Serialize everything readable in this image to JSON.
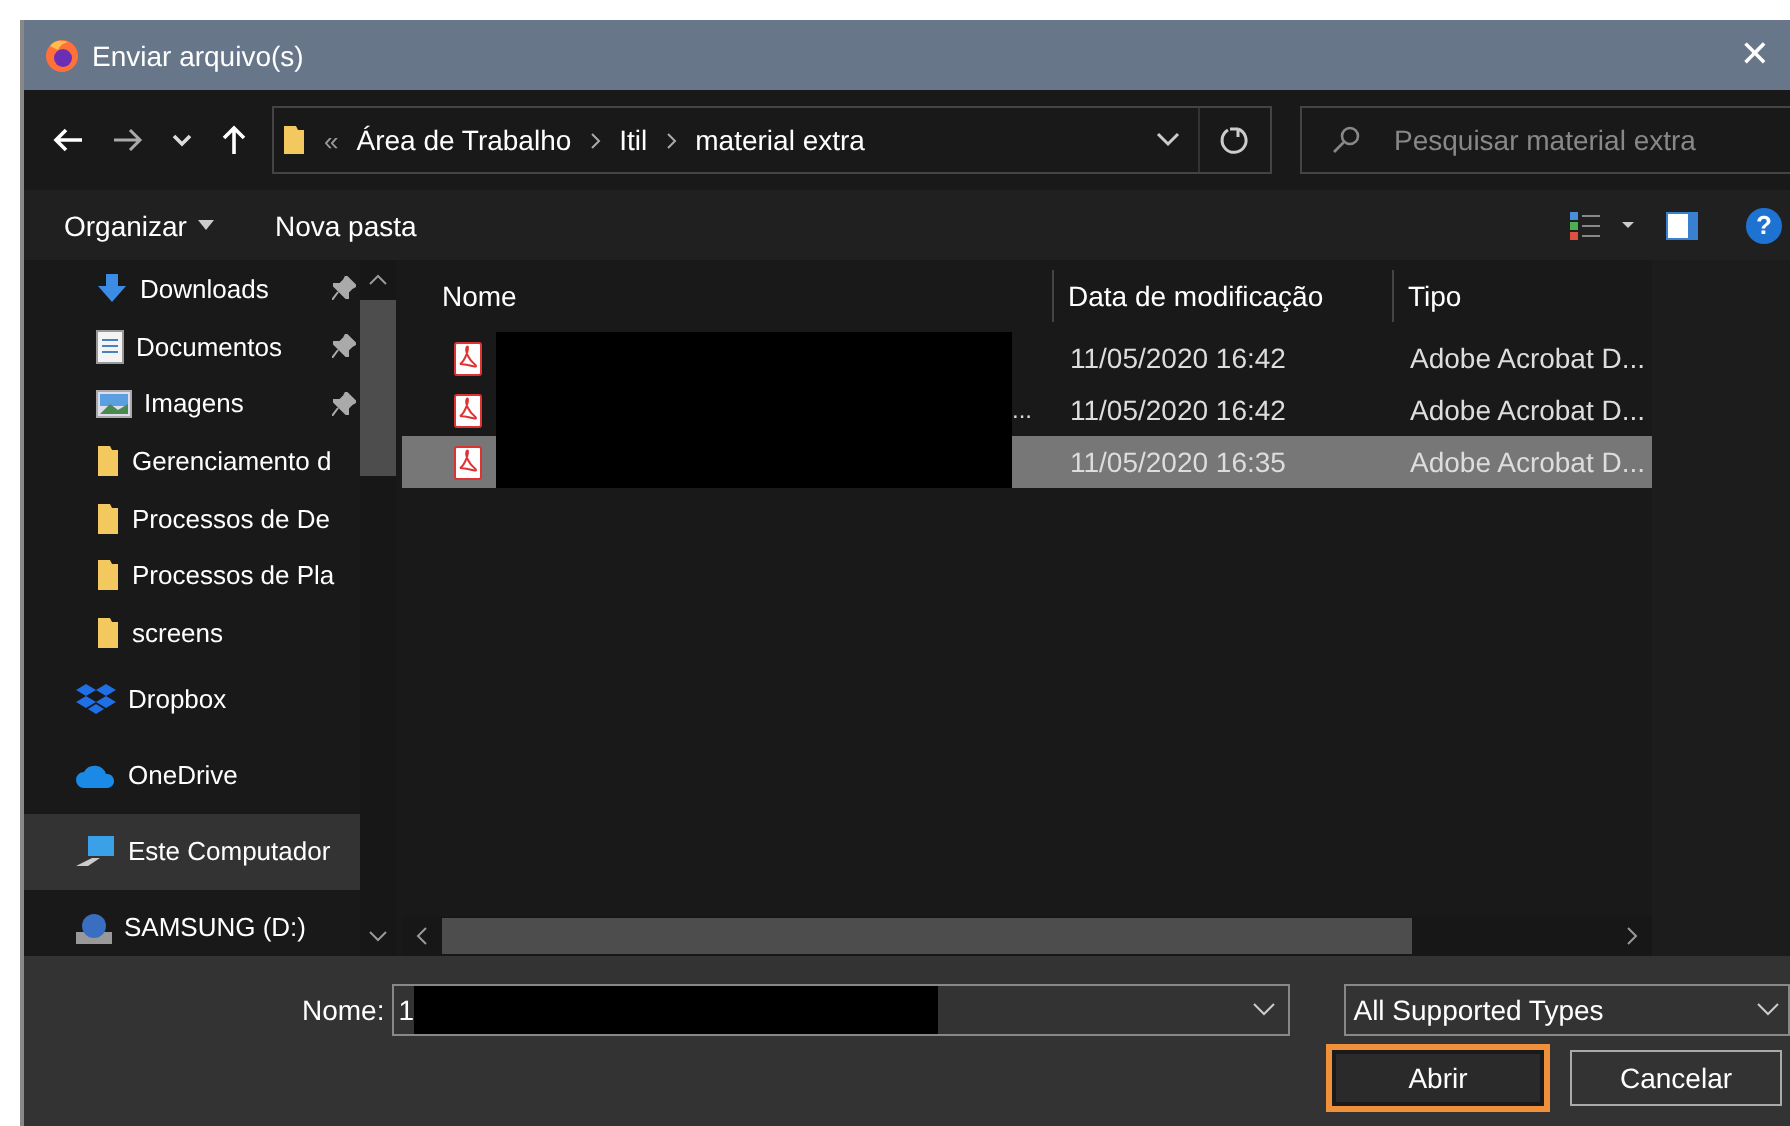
{
  "window": {
    "title": "Enviar arquivo(s)",
    "close": "✕"
  },
  "address": {
    "overflow": "«",
    "crumbs": [
      "Área de Trabalho",
      "Itil",
      "material extra"
    ]
  },
  "search": {
    "placeholder": "Pesquisar material extra"
  },
  "toolbar": {
    "organize": "Organizar",
    "new_folder": "Nova pasta",
    "help": "?"
  },
  "sidebar": {
    "items": [
      {
        "label": "Downloads",
        "kind": "download",
        "pinned": true,
        "selected": false
      },
      {
        "label": "Documentos",
        "kind": "document",
        "pinned": true,
        "selected": false
      },
      {
        "label": "Imagens",
        "kind": "image",
        "pinned": true,
        "selected": false
      },
      {
        "label": "Gerenciamento d",
        "kind": "folder",
        "pinned": false,
        "selected": false
      },
      {
        "label": "Processos de De",
        "kind": "folder",
        "pinned": false,
        "selected": false
      },
      {
        "label": "Processos de Pla",
        "kind": "folder",
        "pinned": false,
        "selected": false
      },
      {
        "label": "screens",
        "kind": "folder",
        "pinned": false,
        "selected": false
      },
      {
        "label": "Dropbox",
        "kind": "dropbox",
        "pinned": false,
        "selected": false
      },
      {
        "label": "OneDrive",
        "kind": "cloud",
        "pinned": false,
        "selected": false
      },
      {
        "label": "Este Computador",
        "kind": "computer",
        "pinned": false,
        "selected": true
      },
      {
        "label": "SAMSUNG (D:)",
        "kind": "drive",
        "pinned": false,
        "selected": false
      }
    ]
  },
  "table": {
    "columns": [
      "Nome",
      "Data de modificação",
      "Tipo"
    ],
    "rows": [
      {
        "redacted": true,
        "modified": "11/05/2020 16:42",
        "type": "Adobe Acrobat D...",
        "selected": false
      },
      {
        "name": "...",
        "redacted": true,
        "modified": "11/05/2020 16:42",
        "type": "Adobe Acrobat D...",
        "selected": false
      },
      {
        "redacted": true,
        "modified": "11/05/2020 16:35",
        "type": "Adobe Acrobat D...",
        "selected": true
      }
    ]
  },
  "footer": {
    "name_label": "Nome:",
    "name_value": "1",
    "name_redacted": true,
    "filter": "All Supported Types",
    "buttons": [
      {
        "label": "Abrir",
        "focused": true
      },
      {
        "label": "Cancelar",
        "focused": false
      }
    ]
  }
}
